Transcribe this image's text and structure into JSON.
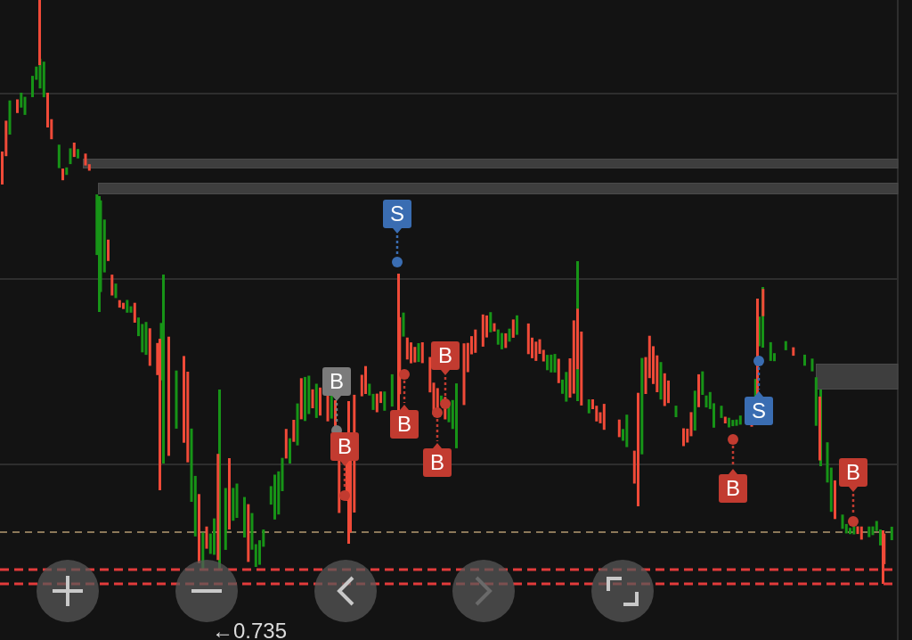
{
  "chart": {
    "markers": [
      {
        "label": "B",
        "color": "#7b7b7b"
      },
      {
        "label": "B",
        "color": "#c23b30"
      },
      {
        "label": "S",
        "color": "#3a6db2"
      },
      {
        "label": "B",
        "color": "#c23b30"
      },
      {
        "label": "B",
        "color": "#c23b30"
      },
      {
        "label": "B",
        "color": "#c23b30"
      },
      {
        "label": "B",
        "color": "#c23b30"
      },
      {
        "label": "S",
        "color": "#3a6db2"
      },
      {
        "label": "B",
        "color": "#c23b30"
      }
    ],
    "price_label": "←0.735"
  },
  "controls": [
    {
      "kind": "zoom_in",
      "disabled": false
    },
    {
      "kind": "zoom_out",
      "disabled": false
    },
    {
      "kind": "scroll_back",
      "disabled": false
    },
    {
      "kind": "scroll_forward",
      "disabled": true
    },
    {
      "kind": "fullscreen",
      "disabled": false
    }
  ]
}
